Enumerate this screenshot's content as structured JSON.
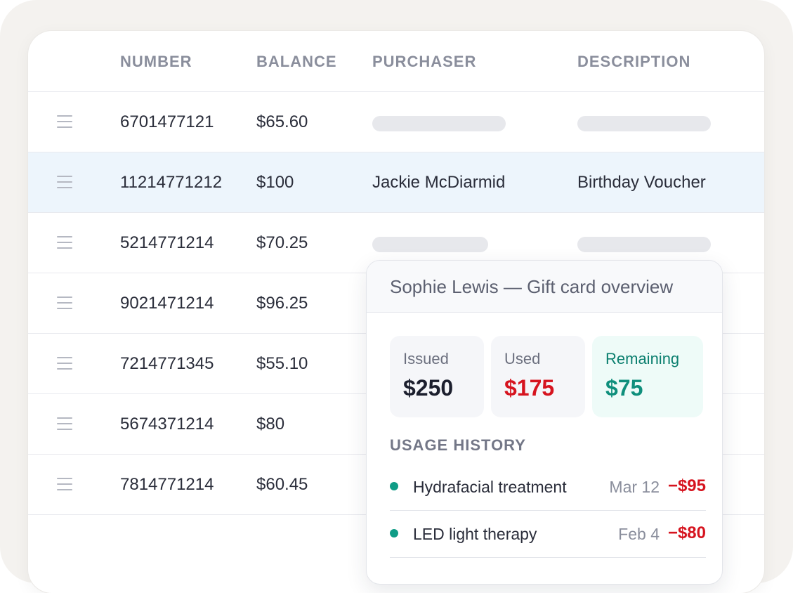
{
  "table": {
    "headers": {
      "number": "NUMBER",
      "balance": "BALANCE",
      "purchaser": "PURCHASER",
      "description": "DESCRIPTION"
    },
    "rows": [
      {
        "number": "6701477121",
        "balance": "$65.60",
        "purchaser": "",
        "description": ""
      },
      {
        "number": "11214771212",
        "balance": "$100",
        "purchaser": "Jackie McDiarmid",
        "description": "Birthday Voucher"
      },
      {
        "number": "5214771214",
        "balance": "$70.25",
        "purchaser": "",
        "description": ""
      },
      {
        "number": "9021471214",
        "balance": "$96.25",
        "purchaser": "",
        "description": ""
      },
      {
        "number": "7214771345",
        "balance": "$55.10",
        "purchaser": "",
        "description": ""
      },
      {
        "number": "5674371214",
        "balance": "$80",
        "purchaser": "",
        "description": ""
      },
      {
        "number": "7814771214",
        "balance": "$60.45",
        "purchaser": "",
        "description": ""
      }
    ]
  },
  "popover": {
    "title": "Sophie Lewis — Gift card overview",
    "stats": {
      "issued": {
        "label": "Issued",
        "value": "$250"
      },
      "used": {
        "label": "Used",
        "value": "$175"
      },
      "remaining": {
        "label": "Remaining",
        "value": "$75"
      }
    },
    "history_label": "USAGE HISTORY",
    "history": [
      {
        "name": "Hydrafacial treatment",
        "date": "Mar 12",
        "amount": "−$95"
      },
      {
        "name": "LED light therapy",
        "date": "Feb 4",
        "amount": "−$80"
      }
    ]
  },
  "colors": {
    "selected_row": "#edf5fc",
    "negative": "#d6141f",
    "positive": "#0f8f7c",
    "history_dot": "#0f9c86"
  },
  "icons": {
    "row_handle": "drag-handle-icon"
  }
}
